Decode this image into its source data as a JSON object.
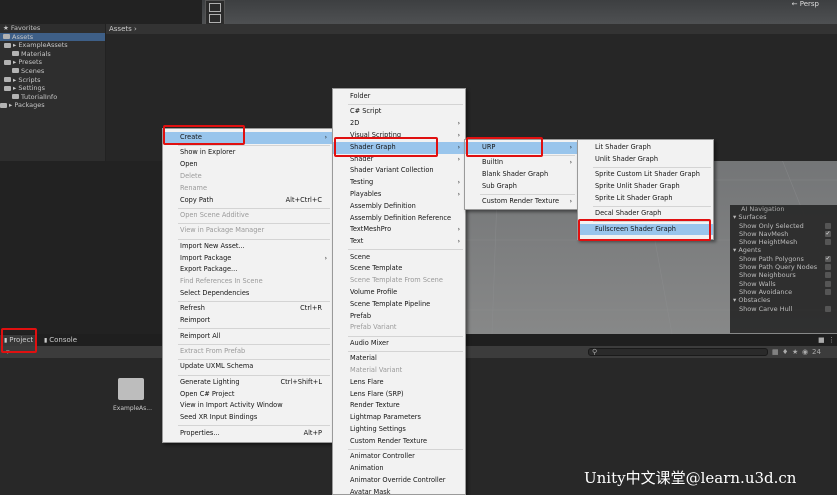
{
  "scene": {
    "view_label": "← Persp"
  },
  "ai_navigation": {
    "title": "AI Navigation",
    "rows": [
      {
        "type": "header",
        "label": "▾ Surfaces"
      },
      {
        "type": "option",
        "label": "Show Only Selected",
        "checked": false
      },
      {
        "type": "option",
        "label": "Show NavMesh",
        "checked": true
      },
      {
        "type": "option",
        "label": "Show HeightMesh",
        "checked": false
      },
      {
        "type": "header",
        "label": "▾ Agents"
      },
      {
        "type": "option",
        "label": "Show Path Polygons",
        "checked": true
      },
      {
        "type": "option",
        "label": "Show Path Query Nodes",
        "checked": false
      },
      {
        "type": "option",
        "label": "Show Neighbours",
        "checked": false
      },
      {
        "type": "option",
        "label": "Show Walls",
        "checked": false
      },
      {
        "type": "option",
        "label": "Show Avoidance",
        "checked": false
      },
      {
        "type": "header",
        "label": "▾ Obstacles"
      },
      {
        "type": "option",
        "label": "Show Carve Hull",
        "checked": false
      }
    ]
  },
  "project": {
    "tabs": [
      "Project",
      "Console"
    ],
    "breadcrumb": "Assets ›",
    "count_label": "24",
    "sidebar": [
      {
        "label": "★ Favorites",
        "indent": 3,
        "folder": false,
        "selected": false
      },
      {
        "label": "Assets",
        "indent": 3,
        "folder": true,
        "selected": true
      },
      {
        "label": "▸ ExampleAssets",
        "indent": 4,
        "folder": true,
        "selected": false
      },
      {
        "label": "Materials",
        "indent": 12,
        "folder": true,
        "selected": false
      },
      {
        "label": "▸ Presets",
        "indent": 4,
        "folder": true,
        "selected": false
      },
      {
        "label": "Scenes",
        "indent": 12,
        "folder": true,
        "selected": false
      },
      {
        "label": "▸ Scripts",
        "indent": 4,
        "folder": true,
        "selected": false
      },
      {
        "label": "▸ Settings",
        "indent": 4,
        "folder": true,
        "selected": false
      },
      {
        "label": "TutorialInfo",
        "indent": 12,
        "folder": true,
        "selected": false
      },
      {
        "label": "▸ Packages",
        "indent": 0,
        "folder": true,
        "selected": false
      }
    ],
    "assets": [
      {
        "label": "ExampleAs..."
      }
    ]
  },
  "menu1": {
    "items": [
      {
        "label": "Create",
        "arrow": true,
        "highlighted": true
      },
      {
        "sep": true
      },
      {
        "label": "Show in Explorer"
      },
      {
        "label": "Open"
      },
      {
        "label": "Delete",
        "disabled": true
      },
      {
        "label": "Rename",
        "disabled": true
      },
      {
        "label": "Copy Path",
        "shortcut": "Alt+Ctrl+C"
      },
      {
        "sep": true
      },
      {
        "label": "Open Scene Additive",
        "disabled": true
      },
      {
        "sep": true
      },
      {
        "label": "View in Package Manager",
        "disabled": true
      },
      {
        "sep": true
      },
      {
        "label": "Import New Asset..."
      },
      {
        "label": "Import Package",
        "arrow": true
      },
      {
        "label": "Export Package..."
      },
      {
        "label": "Find References In Scene",
        "disabled": true
      },
      {
        "label": "Select Dependencies"
      },
      {
        "sep": true
      },
      {
        "label": "Refresh",
        "shortcut": "Ctrl+R"
      },
      {
        "label": "Reimport"
      },
      {
        "sep": true
      },
      {
        "label": "Reimport All"
      },
      {
        "sep": true
      },
      {
        "label": "Extract From Prefab",
        "disabled": true
      },
      {
        "sep": true
      },
      {
        "label": "Update UXML Schema"
      },
      {
        "sep": true
      },
      {
        "label": "Generate Lighting",
        "shortcut": "Ctrl+Shift+L"
      },
      {
        "label": "Open C# Project"
      },
      {
        "label": "View in Import Activity Window"
      },
      {
        "label": "Seed XR Input Bindings"
      },
      {
        "sep": true
      },
      {
        "label": "Properties...",
        "shortcut": "Alt+P"
      }
    ]
  },
  "menu2": {
    "items": [
      {
        "label": "Folder"
      },
      {
        "sep": true
      },
      {
        "label": "C# Script"
      },
      {
        "label": "2D",
        "arrow": true
      },
      {
        "label": "Visual Scripting",
        "arrow": true
      },
      {
        "label": "Shader Graph",
        "arrow": true,
        "highlighted": true
      },
      {
        "label": "Shader",
        "arrow": true
      },
      {
        "label": "Shader Variant Collection"
      },
      {
        "label": "Testing",
        "arrow": true
      },
      {
        "label": "Playables",
        "arrow": true
      },
      {
        "label": "Assembly Definition"
      },
      {
        "label": "Assembly Definition Reference"
      },
      {
        "label": "TextMeshPro",
        "arrow": true
      },
      {
        "label": "Text",
        "arrow": true
      },
      {
        "sep": true
      },
      {
        "label": "Scene"
      },
      {
        "label": "Scene Template"
      },
      {
        "label": "Scene Template From Scene",
        "disabled": true
      },
      {
        "label": "Volume Profile"
      },
      {
        "label": "Scene Template Pipeline"
      },
      {
        "label": "Prefab"
      },
      {
        "label": "Prefab Variant",
        "disabled": true
      },
      {
        "sep": true
      },
      {
        "label": "Audio Mixer"
      },
      {
        "sep": true
      },
      {
        "label": "Material"
      },
      {
        "label": "Material Variant",
        "disabled": true
      },
      {
        "label": "Lens Flare"
      },
      {
        "label": "Lens Flare (SRP)"
      },
      {
        "label": "Render Texture"
      },
      {
        "label": "Lightmap Parameters"
      },
      {
        "label": "Lighting Settings"
      },
      {
        "label": "Custom Render Texture"
      },
      {
        "sep": true
      },
      {
        "label": "Animator Controller"
      },
      {
        "label": "Animation"
      },
      {
        "label": "Animator Override Controller"
      },
      {
        "label": "Avatar Mask"
      }
    ]
  },
  "menu3": {
    "items": [
      {
        "label": "URP",
        "arrow": true,
        "highlighted": true
      },
      {
        "sep": true
      },
      {
        "label": "BuiltIn",
        "arrow": true
      },
      {
        "label": "Blank Shader Graph"
      },
      {
        "label": "Sub Graph"
      },
      {
        "sep": true
      },
      {
        "label": "Custom Render Texture",
        "arrow": true
      }
    ]
  },
  "menu4": {
    "items": [
      {
        "label": "Lit Shader Graph"
      },
      {
        "label": "Unlit Shader Graph"
      },
      {
        "sep": true
      },
      {
        "label": "Sprite Custom Lit Shader Graph"
      },
      {
        "label": "Sprite Unlit Shader Graph"
      },
      {
        "label": "Sprite Lit Shader Graph"
      },
      {
        "sep": true
      },
      {
        "label": "Decal Shader Graph"
      },
      {
        "sep": true
      },
      {
        "label": "Fullscreen Shader Graph",
        "highlighted": true
      }
    ]
  },
  "watermark": "Unity中文课堂@learn.u3d.cn",
  "colors": {
    "highlight": "#99c5ec",
    "annotation_red": "#e01010",
    "selection_blue": "#3e5f87"
  }
}
